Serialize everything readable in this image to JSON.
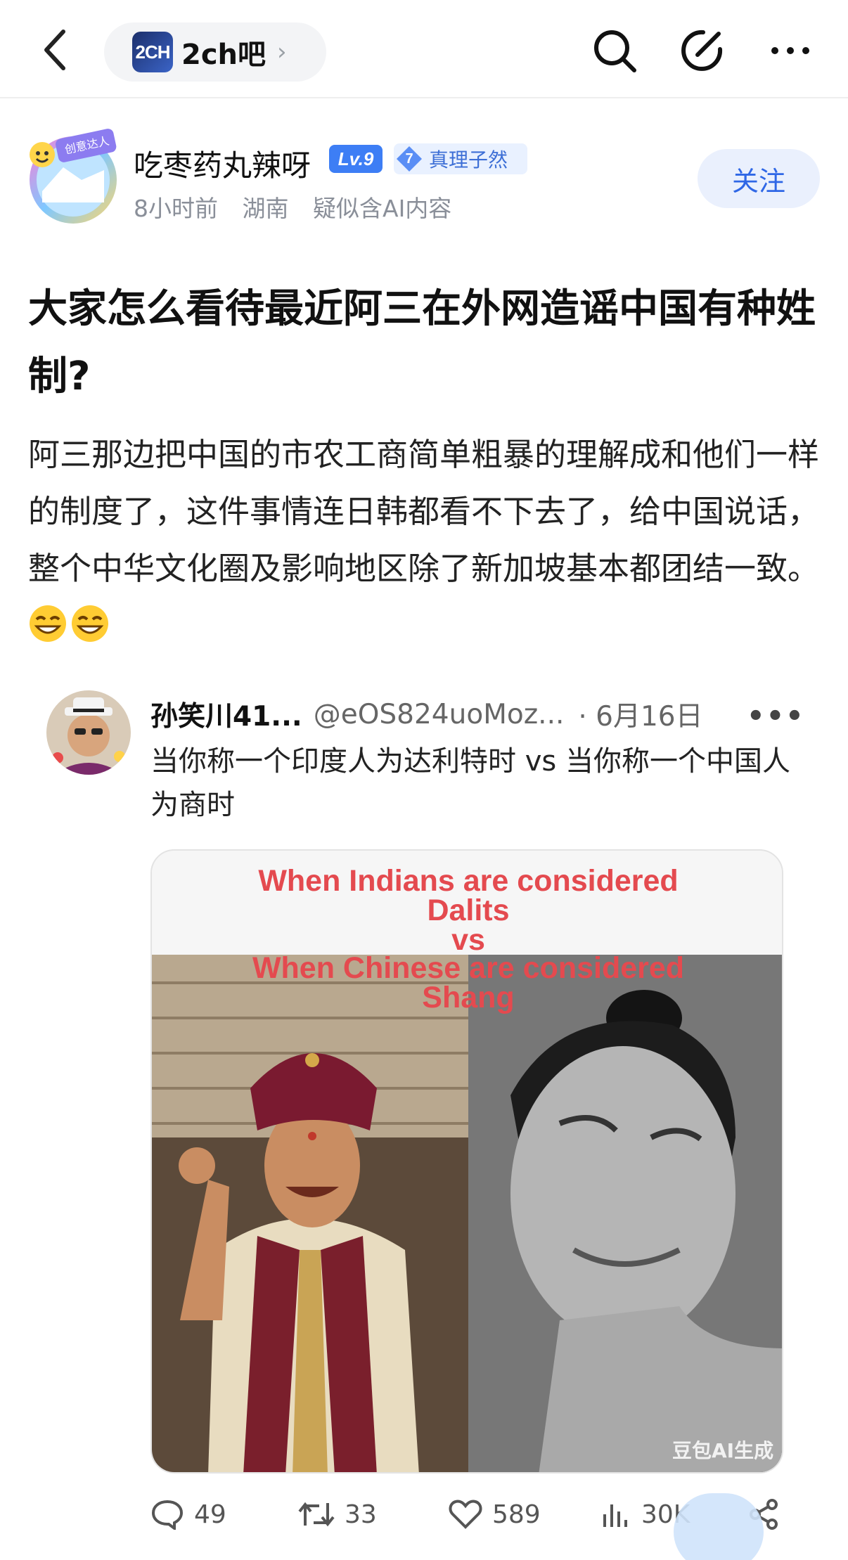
{
  "header": {
    "forum_logo": "2CH",
    "forum_name": "2ch吧",
    "icons": [
      "back-arrow-icon",
      "search-icon",
      "edit-icon",
      "more-icon"
    ]
  },
  "author": {
    "avatar_badge": "创意达人",
    "name": "吃枣药丸辣呀",
    "level": "Lv.9",
    "title_level": "7",
    "title": "真理子然",
    "time": "8小时前",
    "location": "湖南",
    "ai_note": "疑似含AI内容",
    "follow_label": "关注"
  },
  "post": {
    "title": "大家怎么看待最近阿三在外网造谣中国有种姓制?",
    "body": "阿三那边把中国的市农工商简单粗暴的理解成和他们一样的制度了，这件事情连日韩都看不下去了，给中国说话，整个中华文化圈及影响地区除了新加坡基本都团结一致。"
  },
  "tweet": {
    "name": "孙笑川41...",
    "handle": "@eOS824uoMoz...",
    "date": "· 6月16日",
    "more": "•••",
    "text": "当你称一个印度人为达利特时 vs 当你称一个中国人为商时",
    "image_caption": {
      "line1": "When Indians are considered",
      "line2": "Dalits",
      "line3": "vs",
      "line4": "When Chinese are considered",
      "line5": "Shang"
    },
    "watermark": "豆包AI生成"
  },
  "actions": {
    "replies": "49",
    "reposts": "33",
    "likes": "589",
    "views": "30K"
  },
  "colors": {
    "accent": "#2f67e6",
    "caption_red": "#e44a4f",
    "level_blue": "#3d7ef5"
  }
}
